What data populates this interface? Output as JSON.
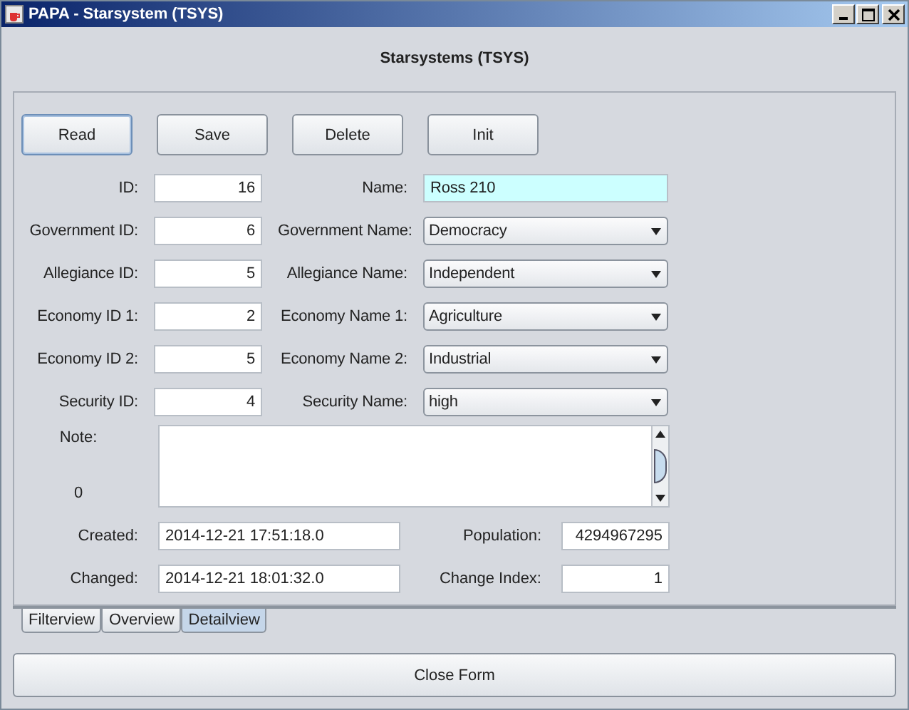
{
  "window": {
    "title": "PAPA - Starsystem (TSYS)"
  },
  "heading": "Starsystems (TSYS)",
  "buttons": [
    {
      "label": "Read",
      "focused": true
    },
    {
      "label": "Save",
      "focused": false
    },
    {
      "label": "Delete",
      "focused": false
    },
    {
      "label": "Init",
      "focused": false
    }
  ],
  "rows": [
    {
      "id_label": "ID:",
      "id_value": "16",
      "name_label": "Name:",
      "name_value": "Ross 210",
      "kind": "text",
      "focused": true
    },
    {
      "id_label": "Government ID:",
      "id_value": "6",
      "name_label": "Government Name:",
      "name_value": "Democracy",
      "kind": "combo",
      "focused": false
    },
    {
      "id_label": "Allegiance ID:",
      "id_value": "5",
      "name_label": "Allegiance Name:",
      "name_value": "Independent",
      "kind": "combo",
      "focused": false
    },
    {
      "id_label": "Economy ID 1:",
      "id_value": "2",
      "name_label": "Economy Name 1:",
      "name_value": "Agriculture",
      "kind": "combo",
      "focused": false
    },
    {
      "id_label": "Economy ID 2:",
      "id_value": "5",
      "name_label": "Economy Name 2:",
      "name_value": "Industrial",
      "kind": "combo",
      "focused": false
    },
    {
      "id_label": "Security ID:",
      "id_value": "4",
      "name_label": "Security Name:",
      "name_value": "high",
      "kind": "combo",
      "focused": false
    }
  ],
  "note": {
    "label": "Note:",
    "count": "0"
  },
  "info": [
    {
      "label": "Created:",
      "value": "2014-12-21 17:51:18.0",
      "label2": "Population:",
      "value2": "4294967295"
    },
    {
      "label": "Changed:",
      "value": "2014-12-21 18:01:32.0",
      "label2": "Change Index:",
      "value2": "1"
    }
  ],
  "tabs": [
    {
      "label": "Filterview",
      "selected": false
    },
    {
      "label": "Overview",
      "selected": false
    },
    {
      "label": "Detailview",
      "selected": true
    }
  ],
  "close_button": "Close Form"
}
